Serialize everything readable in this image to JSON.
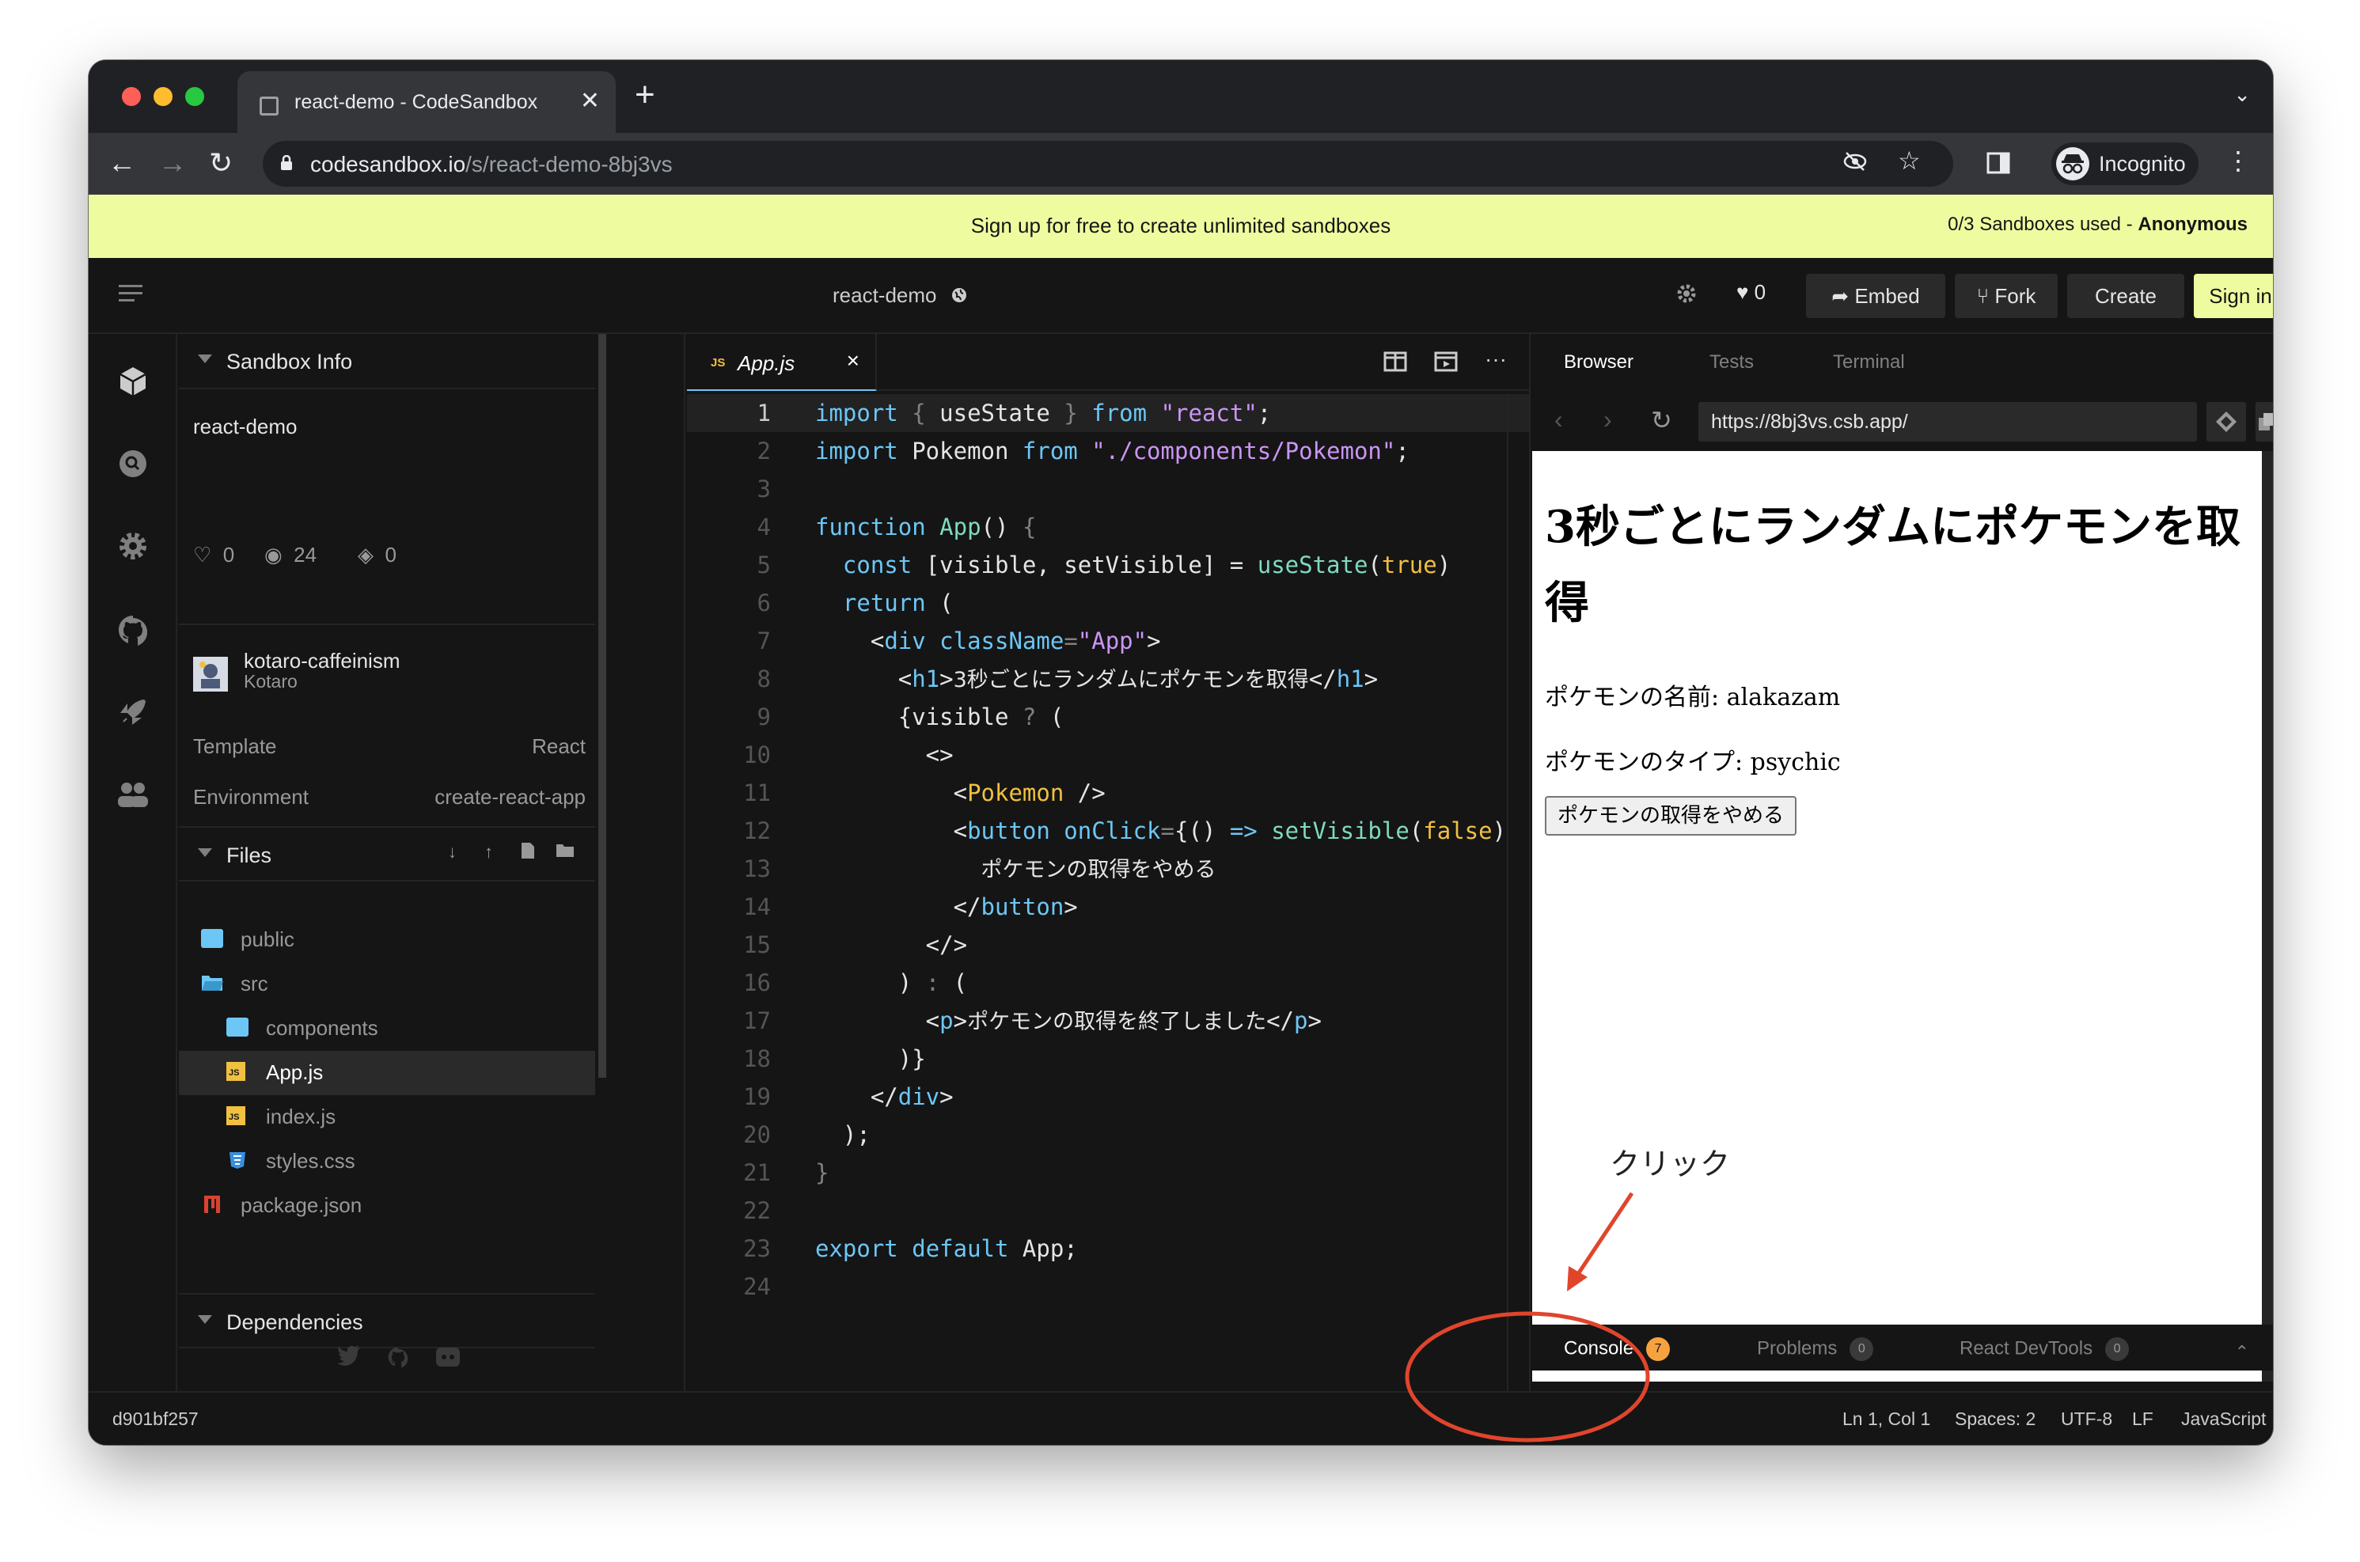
{
  "browser": {
    "tab_title": "react-demo - CodeSandbox",
    "tab_close": "✕",
    "new_tab": "+",
    "tab_menu": "⌄",
    "url_host": "codesandbox.io",
    "url_path": "/s/react-demo-8bj3vs",
    "incognito_label": "Incognito"
  },
  "banner": {
    "text": "Sign up for free to create unlimited sandboxes",
    "usage": "0/3 Sandboxes used - ",
    "usage_user": "Anonymous"
  },
  "header": {
    "sandbox_name": "react-demo",
    "likes": "0",
    "embed": "Embed",
    "fork": "Fork",
    "create": "Create",
    "sign_in": "Sign in"
  },
  "sidebar": {
    "info_title": "Sandbox Info",
    "sandbox_name": "react-demo",
    "likes": "0",
    "views": "24",
    "forks": "0",
    "author_handle": "kotaro-caffeinism",
    "author_name": "Kotaro",
    "template_label": "Template",
    "template_value": "React",
    "environment_label": "Environment",
    "environment_value": "create-react-app",
    "files_title": "Files",
    "files": [
      {
        "name": "public"
      },
      {
        "name": "src"
      },
      {
        "name": "components"
      },
      {
        "name": "App.js"
      },
      {
        "name": "index.js"
      },
      {
        "name": "styles.css"
      },
      {
        "name": "package.json"
      }
    ],
    "dependencies_title": "Dependencies"
  },
  "editor": {
    "tab_lang": "JS",
    "tab_name": "App.js",
    "tab_close": "×",
    "line_numbers": [
      "1",
      "2",
      "3",
      "4",
      "5",
      "6",
      "7",
      "8",
      "9",
      "10",
      "11",
      "12",
      "13",
      "14",
      "15",
      "16",
      "17",
      "18",
      "19",
      "20",
      "21",
      "22",
      "23",
      "24"
    ]
  },
  "preview": {
    "tabs": [
      "Browser",
      "Tests",
      "Terminal"
    ],
    "url": "https://8bj3vs.csb.app/",
    "heading": "3秒ごとにランダムにポケモンを取得",
    "pokemon_name": "ポケモンの名前: alakazam",
    "pokemon_type": "ポケモンのタイプ: psychic",
    "stop_button": "ポケモンの取得をやめる",
    "bottom_tabs": {
      "console": "Console",
      "console_count": "7",
      "problems": "Problems",
      "problems_count": "0",
      "devtools": "React DevTools",
      "devtools_count": "0"
    }
  },
  "status": {
    "commit": "d901bf257",
    "position": "Ln 1, Col 1",
    "spaces": "Spaces: 2",
    "encoding": "UTF-8",
    "eol": "LF",
    "language": "JavaScript"
  },
  "annotation": {
    "text": "クリック",
    "color": "#e0452c"
  }
}
